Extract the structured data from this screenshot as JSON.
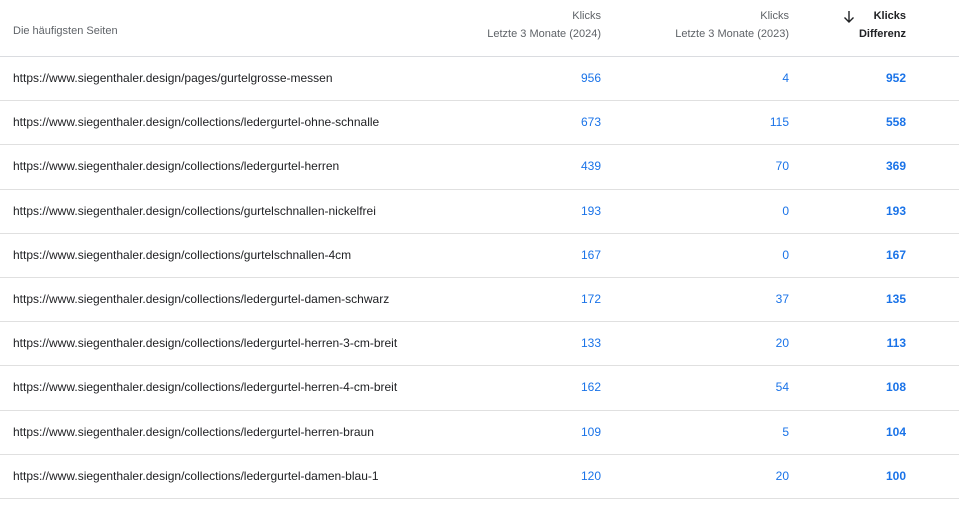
{
  "header": {
    "page_col": "Die häufigsten Seiten",
    "col1_title": "Klicks",
    "col1_sub": "Letzte 3 Monate (2024)",
    "col2_title": "Klicks",
    "col2_sub": "Letzte 3 Monate (2023)",
    "col3_title": "Klicks",
    "col3_sub": "Differenz",
    "sort_icon": "arrow-down-icon"
  },
  "rows": [
    {
      "url": "https://www.siegenthaler.design/pages/gurtelgrosse-messen",
      "clicks_2024": "956",
      "clicks_2023": "4",
      "diff": "952"
    },
    {
      "url": "https://www.siegenthaler.design/collections/ledergurtel-ohne-schnalle",
      "clicks_2024": "673",
      "clicks_2023": "115",
      "diff": "558"
    },
    {
      "url": "https://www.siegenthaler.design/collections/ledergurtel-herren",
      "clicks_2024": "439",
      "clicks_2023": "70",
      "diff": "369"
    },
    {
      "url": "https://www.siegenthaler.design/collections/gurtelschnallen-nickelfrei",
      "clicks_2024": "193",
      "clicks_2023": "0",
      "diff": "193"
    },
    {
      "url": "https://www.siegenthaler.design/collections/gurtelschnallen-4cm",
      "clicks_2024": "167",
      "clicks_2023": "0",
      "diff": "167"
    },
    {
      "url": "https://www.siegenthaler.design/collections/ledergurtel-damen-schwarz",
      "clicks_2024": "172",
      "clicks_2023": "37",
      "diff": "135"
    },
    {
      "url": "https://www.siegenthaler.design/collections/ledergurtel-herren-3-cm-breit",
      "clicks_2024": "133",
      "clicks_2023": "20",
      "diff": "113"
    },
    {
      "url": "https://www.siegenthaler.design/collections/ledergurtel-herren-4-cm-breit",
      "clicks_2024": "162",
      "clicks_2023": "54",
      "diff": "108"
    },
    {
      "url": "https://www.siegenthaler.design/collections/ledergurtel-herren-braun",
      "clicks_2024": "109",
      "clicks_2023": "5",
      "diff": "104"
    },
    {
      "url": "https://www.siegenthaler.design/collections/ledergurtel-damen-blau-1",
      "clicks_2024": "120",
      "clicks_2023": "20",
      "diff": "100"
    }
  ],
  "colors": {
    "link_blue": "#1a73e8",
    "header_grey": "#5f6368",
    "divider": "#e0e0e0"
  }
}
